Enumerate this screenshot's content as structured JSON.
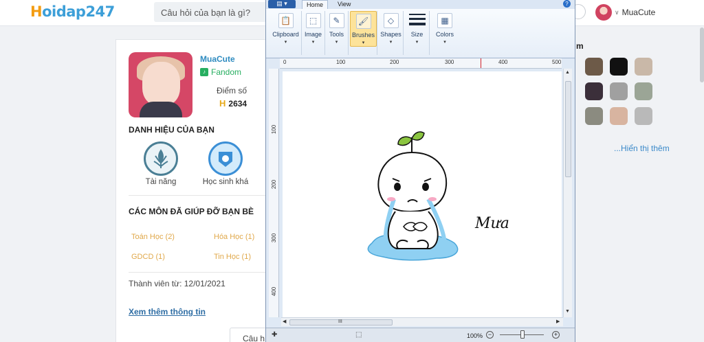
{
  "site": {
    "logo_text": "oidap247",
    "logo_mark": "H"
  },
  "header": {
    "search_placeholder": "Câu hỏi của bạn là gì?",
    "username": "MuaCute"
  },
  "profile": {
    "username": "MuaCute",
    "fandom_label": "Fandom",
    "score_label": "Điểm số",
    "score_value": "2634",
    "titles_heading": "DANH HIỆU CỦA BẠN",
    "badges": [
      {
        "label": "Tài năng"
      },
      {
        "label": "Học sinh khá"
      }
    ],
    "subjects_heading": "CÁC MÔN ĐÃ GIÚP ĐỠ BẠN BÈ",
    "subjects": [
      "Toán Học (2)",
      "Hóa Học (1)",
      "GDCD (1)",
      "Tin Học (1)"
    ],
    "member_since": "Thành viên từ: 12/01/2021",
    "more_info": "Xem thêm thông tin",
    "ask_button": "Câu h"
  },
  "sidebar": {
    "title_fragment": "m",
    "show_more": "...Hiển thị thêm"
  },
  "paint": {
    "tabs": [
      "Home",
      "View"
    ],
    "groups": [
      {
        "label": "Clipboard",
        "icon": "clipboard-icon"
      },
      {
        "label": "Image",
        "icon": "select-icon"
      },
      {
        "label": "Tools",
        "icon": "pencil-icon"
      },
      {
        "label": "Brushes",
        "icon": "brush-icon"
      },
      {
        "label": "Shapes",
        "icon": "shapes-icon"
      },
      {
        "label": "Size",
        "icon": "line-size-icon"
      },
      {
        "label": "Colors",
        "icon": "color-palette-icon"
      }
    ],
    "ruler_h": [
      "0",
      "100",
      "200",
      "300",
      "400",
      "500"
    ],
    "ruler_v": [
      "100",
      "200",
      "300",
      "400"
    ],
    "canvas_text": "Mưa",
    "zoom": "100%",
    "scroll_grip": "III"
  },
  "colors": {
    "accent_blue": "#2e8bc0",
    "fandom_green": "#27ae60",
    "subject_orange": "#e0a84a",
    "brush_highlight": "#fde39a"
  }
}
